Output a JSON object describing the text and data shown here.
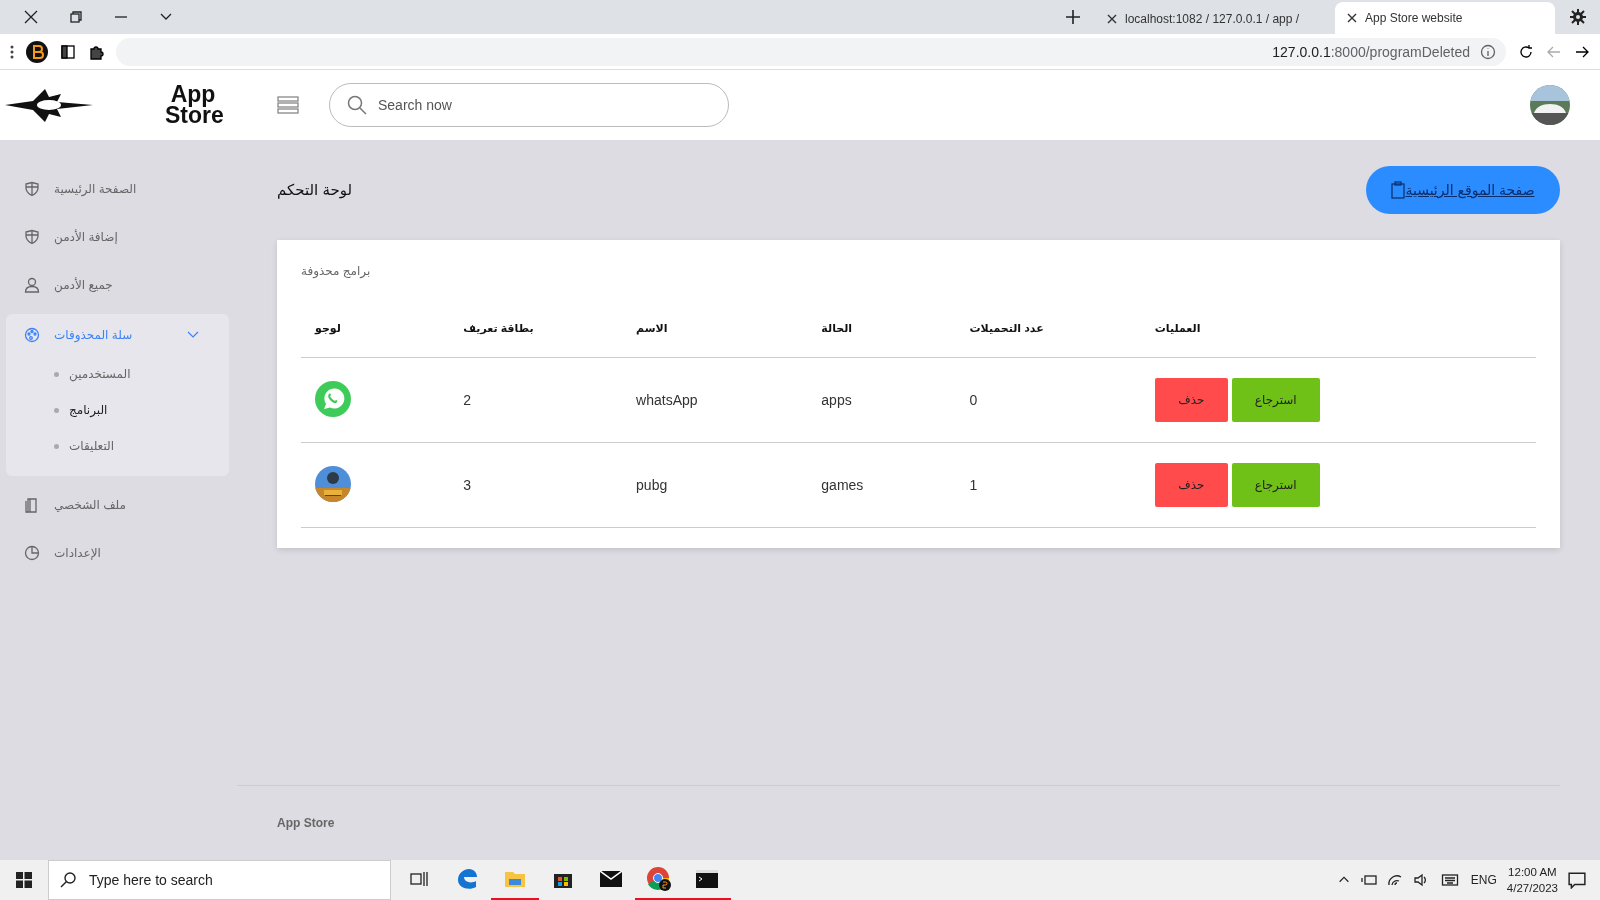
{
  "browser": {
    "tabs": [
      {
        "title": "App Store website",
        "selected": true
      },
      {
        "title": "localhost:1082 / 127.0.0.1 / app /",
        "selected": false
      }
    ],
    "address": {
      "host": "127.0.0.1",
      "rest": ":8000/programDeleted"
    }
  },
  "header": {
    "brand": [
      "App",
      "Store"
    ],
    "search": {
      "placeholder": "Search now"
    }
  },
  "sidebar": {
    "items": [
      {
        "label": "الصفحة الرئيسية",
        "kind": "link"
      },
      {
        "label": "إضافة الأدمن",
        "kind": "link"
      },
      {
        "label": "جميع الأدمن",
        "kind": "link"
      },
      {
        "label": "سلة المحذوفات",
        "kind": "group",
        "expanded": true,
        "children": [
          {
            "label": "المستخدمين",
            "selected": false
          },
          {
            "label": "البرنامج",
            "selected": true
          },
          {
            "label": "التعليقات",
            "selected": false
          }
        ]
      },
      {
        "label": "ملف الشخصي",
        "kind": "link"
      },
      {
        "label": "الإعدادات",
        "kind": "link"
      }
    ]
  },
  "page": {
    "title": "لوحة التحكم",
    "home_button": "صفحة الموقع الرئيسية"
  },
  "table": {
    "caption": "برامج محذوفة",
    "columns": [
      "العمليات",
      "عدد التحميلات",
      "الحالة",
      "الاسم",
      "بطاقة تعريف",
      "لوجو"
    ],
    "rows": [
      {
        "id": "2",
        "name": "whatsApp",
        "status": "apps",
        "downloads": "0",
        "actions": [
          "استرجاع",
          "حذف"
        ]
      },
      {
        "id": "3",
        "name": "pubg",
        "status": "games",
        "downloads": "1",
        "actions": [
          "استرجاع",
          "حذف"
        ]
      }
    ]
  },
  "footer": {
    "text": "App Store"
  },
  "taskbar": {
    "search": {
      "placeholder": "Type here to search"
    },
    "language": "ENG",
    "time": "12:00 AM",
    "date": "4/27/2023"
  }
}
